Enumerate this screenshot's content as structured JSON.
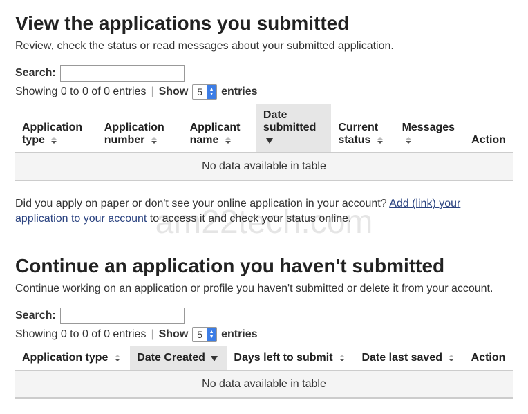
{
  "watermark": "am22tech.com",
  "section1": {
    "title": "View the applications you submitted",
    "subtitle": "Review, check the status or read messages about your submitted application.",
    "searchLabel": "Search:",
    "showing": "Showing 0 to 0 of 0 entries",
    "showLabel": "Show",
    "entriesLabel": "entries",
    "selectValue": "5",
    "cols": {
      "appType": "Application type",
      "appNumber": "Application number",
      "applicantName": "Applicant name",
      "dateSubmitted": "Date submitted",
      "currentStatus": "Current status",
      "messages": "Messages",
      "action": "Action"
    },
    "noData": "No data available in table",
    "paperPrefix": "Did you apply on paper or don't see your online application in your account?  ",
    "paperLink": "Add (link) your application to your account",
    "paperSuffix": " to access it and check your status online."
  },
  "section2": {
    "title": "Continue an application you haven't submitted",
    "subtitle": "Continue working on an application or profile you haven't submitted or delete it from your account.",
    "searchLabel": "Search:",
    "showing": "Showing 0 to 0 of 0 entries",
    "showLabel": "Show",
    "entriesLabel": "entries",
    "selectValue": "5",
    "cols": {
      "appType": "Application type",
      "dateCreated": "Date Created",
      "daysLeft": "Days left to submit",
      "dateSaved": "Date last saved",
      "action": "Action"
    },
    "noData": "No data available in table"
  }
}
